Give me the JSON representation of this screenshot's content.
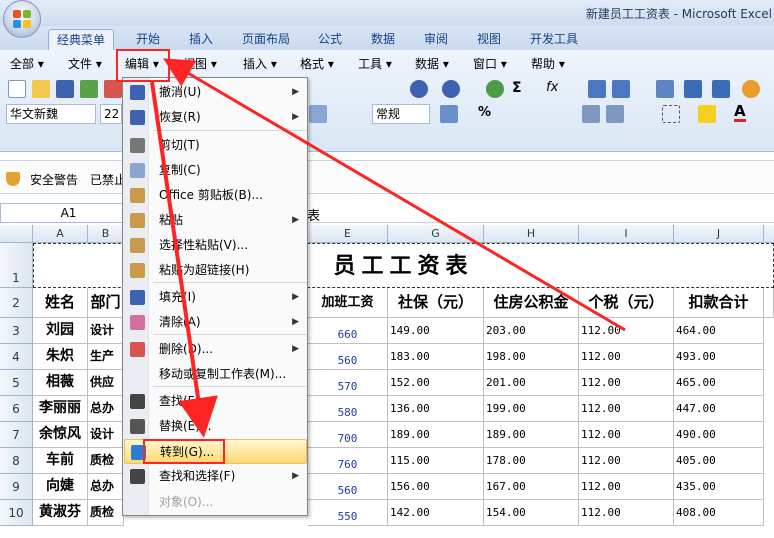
{
  "window": {
    "title": "新建员工工资表 - Microsoft Excel"
  },
  "ribbon_tabs": [
    "经典菜单",
    "开始",
    "插入",
    "页面布局",
    "公式",
    "数据",
    "审阅",
    "视图",
    "开发工具"
  ],
  "classic_menus": [
    "全部",
    "文件",
    "编辑",
    "视图",
    "插入",
    "格式",
    "工具",
    "数据",
    "窗口",
    "帮助"
  ],
  "toolbar": {
    "font_name": "华文新魏",
    "font_size": "22",
    "number_format": "常规",
    "symbols": [
      "Σ",
      "fx",
      "%",
      "A"
    ]
  },
  "security": {
    "label": "安全警告",
    "text": "已禁止"
  },
  "formula_bar": {
    "name_box": "A1",
    "value": "表"
  },
  "columns": [
    "A",
    "B",
    "E",
    "G",
    "H",
    "I",
    "J"
  ],
  "rows": [
    "1",
    "2",
    "3",
    "4",
    "5",
    "6",
    "7",
    "8",
    "9",
    "10"
  ],
  "sheet": {
    "title": "员工工资表",
    "headers": [
      "姓名",
      "部门",
      "加班工资",
      "社保（元）",
      "住房公积金",
      "个税（元）",
      "扣款合计"
    ],
    "data": [
      {
        "name": "刘园",
        "dept": "设计",
        "ot": "660",
        "ss": "149.00",
        "hf": "203.00",
        "tax": "112.00",
        "ded": "464.00"
      },
      {
        "name": "朱炽",
        "dept": "生产",
        "ot": "560",
        "ss": "183.00",
        "hf": "198.00",
        "tax": "112.00",
        "ded": "493.00"
      },
      {
        "name": "相薇",
        "dept": "供应",
        "ot": "570",
        "ss": "152.00",
        "hf": "201.00",
        "tax": "112.00",
        "ded": "465.00"
      },
      {
        "name": "李丽丽",
        "dept": "总办",
        "ot": "580",
        "ss": "136.00",
        "hf": "199.00",
        "tax": "112.00",
        "ded": "447.00"
      },
      {
        "name": "余惊风",
        "dept": "设计",
        "ot": "700",
        "ss": "189.00",
        "hf": "189.00",
        "tax": "112.00",
        "ded": "490.00"
      },
      {
        "name": "车前",
        "dept": "质检",
        "ot": "760",
        "ss": "115.00",
        "hf": "178.00",
        "tax": "112.00",
        "ded": "405.00"
      },
      {
        "name": "向婕",
        "dept": "总办",
        "ot": "560",
        "ss": "156.00",
        "hf": "167.00",
        "tax": "112.00",
        "ded": "435.00"
      },
      {
        "name": "黄淑芬",
        "dept": "质检",
        "ot": "550",
        "ss": "142.00",
        "hf": "154.00",
        "tax": "112.00",
        "ded": "408.00"
      }
    ]
  },
  "edit_menu": {
    "items": [
      {
        "label": "撤消(U)",
        "icon": "undo-icon",
        "submenu": true
      },
      {
        "label": "恢复(R)",
        "icon": "redo-icon",
        "submenu": true
      },
      {
        "label": "剪切(T)",
        "icon": "scissors-icon"
      },
      {
        "label": "复制(C)",
        "icon": "copy-icon"
      },
      {
        "label": "Office 剪贴板(B)...",
        "icon": "clipboard-icon"
      },
      {
        "label": "粘贴",
        "icon": "paste-icon",
        "submenu": true
      },
      {
        "label": "选择性粘贴(V)...",
        "icon": "paste-special-icon"
      },
      {
        "label": "粘贴为超链接(H)",
        "icon": "paste-link-icon"
      },
      {
        "label": "填充(I)",
        "icon": "fill-icon",
        "submenu": true
      },
      {
        "label": "清除(A)",
        "icon": "eraser-icon",
        "submenu": true
      },
      {
        "label": "删除(D)...",
        "icon": "delete-icon",
        "submenu": true
      },
      {
        "label": "移动或复制工作表(M)...",
        "icon": ""
      },
      {
        "label": "查找(F)...",
        "icon": "binoculars-icon"
      },
      {
        "label": "替换(E)...",
        "icon": "replace-icon"
      },
      {
        "label": "转到(G)...",
        "icon": "goto-arrow-icon"
      },
      {
        "label": "查找和选择(F)",
        "icon": "binoculars-icon",
        "submenu": true
      },
      {
        "label": "对象(O)...",
        "icon": "",
        "disabled": true
      }
    ]
  },
  "colors": {
    "highlight_red": "#ff2424",
    "ribbon_blue": "#dbe7f6",
    "menu_hover": "#ffd970"
  }
}
